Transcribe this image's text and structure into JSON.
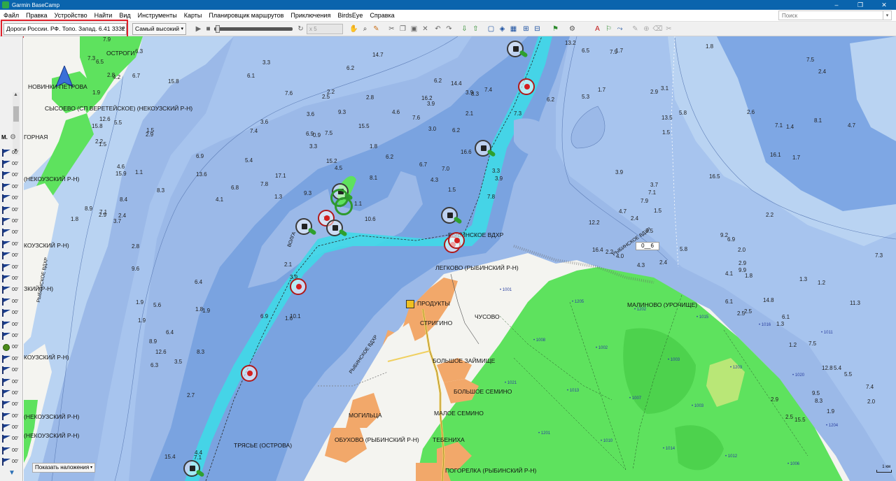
{
  "window": {
    "title": "Garmin BaseCamp",
    "controls": [
      "–",
      "❐",
      "✕"
    ]
  },
  "menu": [
    "Файл",
    "Правка",
    "Устройство",
    "Найти",
    "Вид",
    "Инструменты",
    "Карты",
    "Планировщик маршрутов",
    "Приключения",
    "BirdsEye",
    "Справка"
  ],
  "search": {
    "placeholder": "Поиск"
  },
  "toolbar": {
    "map_product": "Дороги России. РФ. Топо. Запад. 6.41 3332",
    "detail_level": "Самый высокий",
    "speed": "x 5"
  },
  "left_panel": {
    "header": "М.",
    "label_suffix": "00'",
    "waypoint_count": 28,
    "dot_index": 17
  },
  "map": {
    "places": [
      "ОСТРОГИ",
      "НОВИНКИ-ПЕТРОВА",
      "СЫСОЕВО (СП ВЕРЕТЕЙСКОЕ) (НЕКОУЗСКИЙ Р-Н)",
      "ГОРНАЯ",
      "(НЕКОУЗСКИЙ Р-Н)",
      "КОУЗСКИЙ Р-Н)",
      "ЗКИЙ Р-Н)",
      "КОУЗСКИЙ Р-Н)",
      "(НЕКОУЗСКИЙ Р-Н)",
      "(НЕКОУЗСКИЙ Р-Н)",
      "РЫБИНСКОЕ ВДХР",
      "ЛЕГКОВО (РЫБИНСКИЙ Р-Н)",
      "ПРОДУКТЫ",
      "СТРИГИНО",
      "ЧУСОВО",
      "БОЛЬШОЕ ЗАЙМИЩЕ",
      "БОЛЬШОЕ СЕМИНО",
      "МАЛОЕ СЕМИНО",
      "МОГИЛЬЦА",
      "ОБУХОВО (РЫБИНСКИЙ Р-Н)",
      "ТЕБЕНИХА",
      "ТРЯСЬЕ (ОСТРОВА)",
      "ПОГОРЕЛКА (РЫБИНСКИЙ Р-Н)",
      "МАЛИНОВО (УРОЧИЩЕ)",
      "ВОЛГА",
      "РЫБИНСКОЕ ВДХР",
      "РЫБИНСКОЕ ВДХР",
      "РЫБИНСКОЕ ВДХР"
    ],
    "depths": [
      "1.1",
      "1.9",
      "2.2",
      "1.8",
      "1.8",
      "1.5",
      "1.7",
      "1.5",
      "2.4",
      "1.2",
      "1.3",
      "2.4",
      "1.5",
      "1.9",
      "2.5",
      "1.3",
      "1.8",
      "2.1",
      "1.7",
      "2.2",
      "2.6",
      "2.5",
      "2.5",
      "1.9",
      "2.9",
      "2.7",
      "3.3",
      "5.4",
      "3.3",
      "3.3",
      "3.1",
      "3.5",
      "2.2",
      "1.3",
      "1.2",
      "2.8",
      "3.7",
      "4.4",
      "3.0",
      "2.1",
      "2.8",
      "6.2",
      "6.2",
      "5.8",
      "6.9",
      "4.1",
      "5.4",
      "1.8",
      "2.8",
      "3.5",
      "3.6",
      "9.3",
      "3.6",
      "3.9",
      "3.9",
      "4.0",
      "1.8",
      "2.0",
      "1.9",
      "4.2",
      "6.3",
      "6.3",
      "6.1",
      "4.1",
      "4.6",
      "6.2",
      "7.9",
      "7.9",
      "7.1",
      "6.1",
      "8.3",
      "8.9",
      "8.3",
      "8.9",
      "7.4",
      "6.9",
      "7.5",
      "6.7",
      "5.3",
      "2.4",
      "1.4",
      "2.5",
      "5.5",
      "4.6",
      "9.6",
      "8.3",
      "9.3",
      "10.1",
      "10.6",
      "7.8",
      "6.5",
      "9.2",
      "8.1",
      "11.3",
      "12.8",
      "15.9",
      "15.8",
      "15.4",
      "14.7",
      "17.1",
      "15.2",
      "14.4",
      "13.5",
      "12.2",
      "16.5",
      "14.8",
      "15.5",
      "12.6",
      "15.8",
      "12.6",
      "16.2",
      "13.6",
      "15.5",
      "16.6",
      "13.2",
      "16.4",
      "16.1",
      "7.3",
      "7.5",
      "7.3",
      "7.1",
      "6.4",
      "6.2",
      "6.8",
      "6.2",
      "7.0",
      "3.7",
      "4.3",
      "4.7",
      "2.9",
      "2.9",
      "2.9",
      "5.5",
      "5.6",
      "3.9",
      "3.9",
      "4.5",
      "4.3",
      "1.5",
      "2.4",
      "1.7",
      "1.8",
      "2.0",
      "2.2",
      "1.5",
      "1.9",
      "0.9",
      "1.6",
      "1.1",
      "3.9",
      "2.9",
      "4.7",
      "5.8",
      "6.1",
      "7.4",
      "6.5",
      "6.7",
      "6.4",
      "7.6",
      "7.8",
      "8.1",
      "8.3",
      "7.3",
      "7.1",
      "7.5",
      "9.9",
      "9.5",
      "8.4",
      "7.9",
      "7.1",
      "7.6",
      "6.9",
      "6.9",
      "7.4"
    ],
    "spot_heights": [
      "1001",
      "1002",
      "1003",
      "1006",
      "1008",
      "1007",
      "1012",
      "1011",
      "1013",
      "1014",
      "1016",
      "1021",
      "1010",
      "1015",
      "1020",
      "1201",
      "1202",
      "1203",
      "1204",
      "1205",
      "1003"
    ],
    "scale": "1 км",
    "annotation": "0__6",
    "overlay_button": "Показать наложения"
  },
  "colors": {
    "titlebar": "#0a64ad",
    "deep_water": "#7aa3e0",
    "shallow_water": "#b8d2f2",
    "channel": "#3fd9e8",
    "land_white": "#f4f4f0",
    "forest": "#5ee25e",
    "town": "#f2a86a",
    "highlight": "#e0202a"
  }
}
